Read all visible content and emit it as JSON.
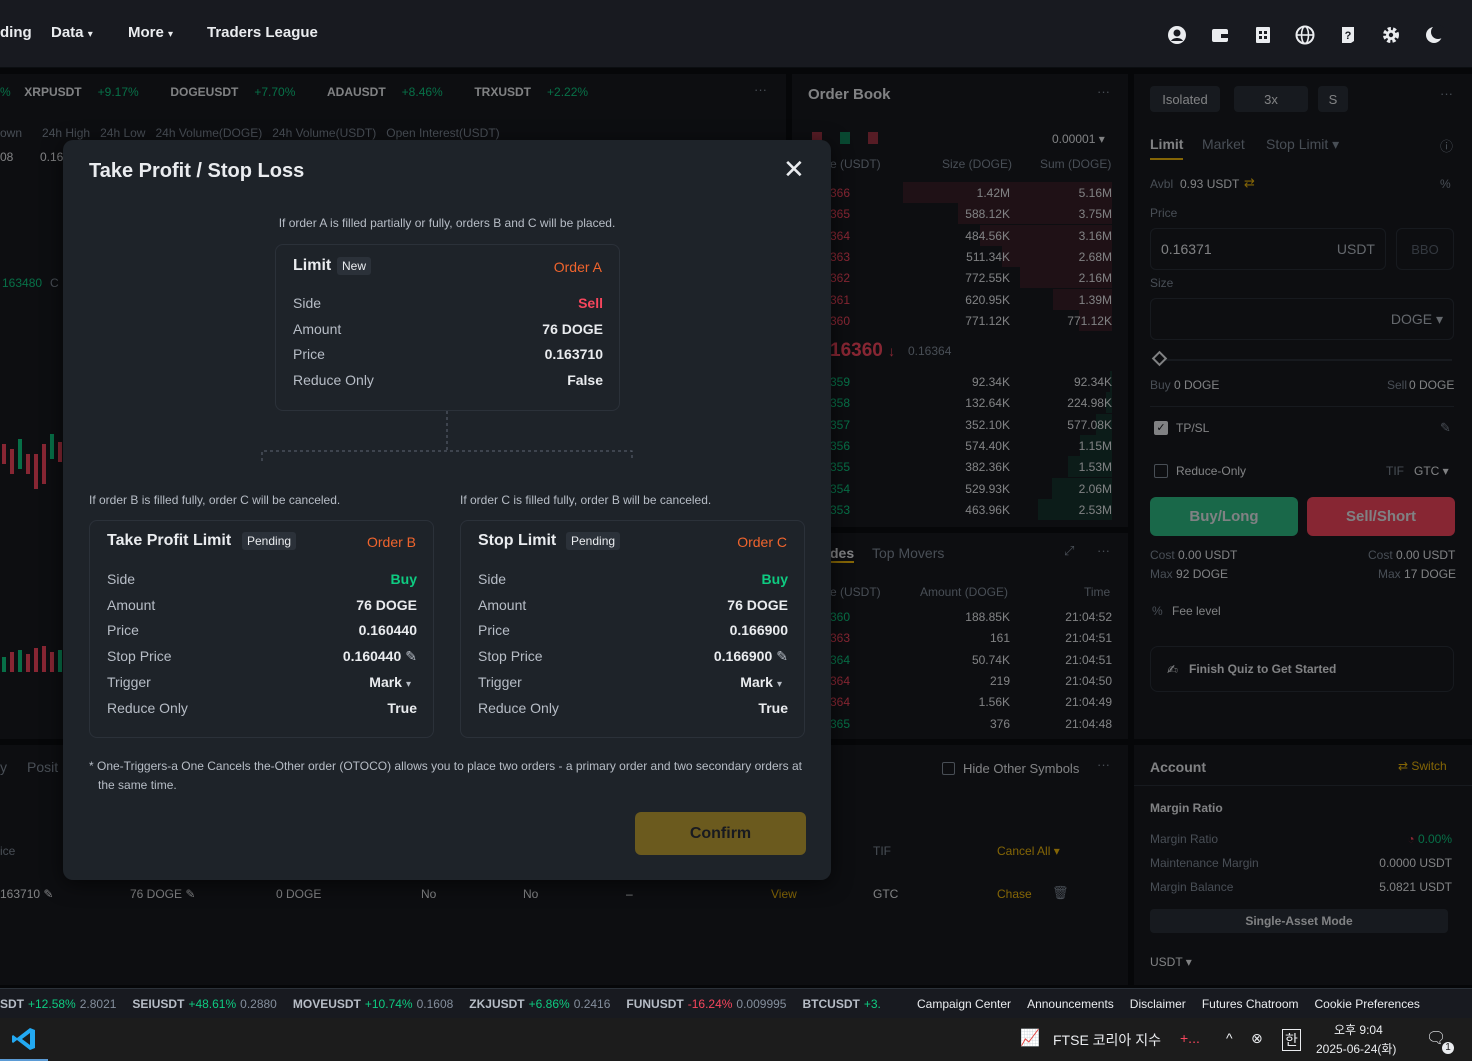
{
  "nav": {
    "partial": "ding",
    "data": "Data",
    "more": "More",
    "traders_league": "Traders League"
  },
  "ticker": [
    {
      "pct_only": "%"
    },
    {
      "sym": "XRPUSDT",
      "pct": "+9.17%"
    },
    {
      "sym": "DOGEUSDT",
      "pct": "+7.70%"
    },
    {
      "sym": "ADAUSDT",
      "pct": "+8.46%"
    },
    {
      "sym": "TRXUSDT",
      "pct": "+2.22%"
    }
  ],
  "stats": {
    "own": "own",
    "high": "24h High",
    "low": "24h Low",
    "vol_doge": "24h Volume(DOGE)",
    "vol_usdt": "24h Volume(USDT)",
    "oi": "Open Interest(USDT)",
    "v1": "08",
    "v2": "0.16"
  },
  "chart_fragment": {
    "price": "163480",
    "c": "C"
  },
  "orderbook": {
    "title": "Order Book",
    "tick": "0.00001",
    "cols": {
      "price": "e (USDT)",
      "size": "Size (DOGE)",
      "sum": "Sum (DOGE)"
    },
    "asks": [
      {
        "p": "366",
        "s": "1.42M",
        "t": "5.16M"
      },
      {
        "p": "365",
        "s": "588.12K",
        "t": "3.75M"
      },
      {
        "p": "364",
        "s": "484.56K",
        "t": "3.16M"
      },
      {
        "p": "363",
        "s": "511.34K",
        "t": "2.68M"
      },
      {
        "p": "362",
        "s": "772.55K",
        "t": "2.16M"
      },
      {
        "p": "361",
        "s": "620.95K",
        "t": "1.39M"
      },
      {
        "p": "360",
        "s": "771.12K",
        "t": "771.12K"
      }
    ],
    "last": "16360",
    "mark": "0.16364",
    "bids": [
      {
        "p": "359",
        "s": "92.34K",
        "t": "92.34K"
      },
      {
        "p": "358",
        "s": "132.64K",
        "t": "224.98K"
      },
      {
        "p": "357",
        "s": "352.10K",
        "t": "577.08K"
      },
      {
        "p": "356",
        "s": "574.40K",
        "t": "1.15M"
      },
      {
        "p": "355",
        "s": "382.36K",
        "t": "1.53M"
      },
      {
        "p": "354",
        "s": "529.93K",
        "t": "2.06M"
      },
      {
        "p": "353",
        "s": "463.96K",
        "t": "2.53M"
      }
    ]
  },
  "trades": {
    "tab1": "des",
    "tab2": "Top Movers",
    "cols": {
      "price": "e (USDT)",
      "amount": "Amount (DOGE)",
      "time": "Time"
    },
    "rows": [
      {
        "p": "360",
        "a": "188.85K",
        "t": "21:04:52",
        "c": "g"
      },
      {
        "p": "363",
        "a": "161",
        "t": "21:04:51",
        "c": "r"
      },
      {
        "p": "364",
        "a": "50.74K",
        "t": "21:04:51",
        "c": "g"
      },
      {
        "p": "364",
        "a": "219",
        "t": "21:04:50",
        "c": "r"
      },
      {
        "p": "364",
        "a": "1.56K",
        "t": "21:04:49",
        "c": "r"
      },
      {
        "p": "365",
        "a": "376",
        "t": "21:04:48",
        "c": "g"
      }
    ]
  },
  "positions": {
    "tab1": "y",
    "tab2": "Posit",
    "hide_other": "Hide Other Symbols",
    "col_ice": "ice",
    "col_tif": "TIF",
    "cancel_all": "Cancel All",
    "row": {
      "price": "163710",
      "amount": "76 DOGE",
      "filled": "0 DOGE",
      "no1": "No",
      "no2": "No",
      "dash": "–",
      "view": "View",
      "tif": "GTC",
      "chase": "Chase"
    }
  },
  "trade_panel": {
    "margin_mode": "Isolated",
    "leverage": "3x",
    "mode_s": "S",
    "tabs": {
      "limit": "Limit",
      "market": "Market",
      "stop_limit": "Stop Limit"
    },
    "avbl_label": "Avbl",
    "avbl": "0.93 USDT",
    "price_label": "Price",
    "price": "0.16371",
    "price_unit": "USDT",
    "bbo": "BBO",
    "size_label": "Size",
    "size_unit": "DOGE",
    "buy_label": "Buy",
    "buy_val": "0 DOGE",
    "sell_label": "Sell",
    "sell_val": "0 DOGE",
    "tpsl": "TP/SL",
    "reduce_only": "Reduce-Only",
    "tif_label": "TIF",
    "tif": "GTC",
    "buy_btn": "Buy/Long",
    "sell_btn": "Sell/Short",
    "cost_label": "Cost",
    "cost_buy": "0.00 USDT",
    "cost_sell": "0.00 USDT",
    "max_label": "Max",
    "max_buy": "92 DOGE",
    "max_sell": "17 DOGE",
    "fee_level": "Fee level",
    "quiz": "Finish Quiz to Get Started"
  },
  "account": {
    "title": "Account",
    "switch": "Switch",
    "margin_ratio_title": "Margin Ratio",
    "rows": [
      {
        "k": "Margin Ratio",
        "v": "0.00%"
      },
      {
        "k": "Maintenance Margin",
        "v": "0.0000 USDT"
      },
      {
        "k": "Margin Balance",
        "v": "5.0821 USDT"
      }
    ],
    "single_asset": "Single-Asset Mode",
    "asset": "USDT"
  },
  "bottom_ticker": [
    {
      "sym": "SDT",
      "pct": "+12.58%",
      "price": "2.8021",
      "c": "g"
    },
    {
      "sym": "SEIUSDT",
      "pct": "+48.61%",
      "price": "0.2880",
      "c": "g"
    },
    {
      "sym": "MOVEUSDT",
      "pct": "+10.74%",
      "price": "0.1608",
      "c": "g"
    },
    {
      "sym": "ZKJUSDT",
      "pct": "+6.86%",
      "price": "0.2416",
      "c": "g"
    },
    {
      "sym": "FUNUSDT",
      "pct": "-16.24%",
      "price": "0.009995",
      "c": "r"
    },
    {
      "sym": "BTCUSDT",
      "pct": "+3.",
      "price": "",
      "c": "g"
    }
  ],
  "bottom_links": [
    "Campaign Center",
    "Announcements",
    "Disclaimer",
    "Futures Chatroom",
    "Cookie Preferences"
  ],
  "modal": {
    "title": "Take Profit / Stop Loss",
    "note_a": "If order A is filled partially or fully, orders B and C will be placed.",
    "note_b": "If order B is filled fully, order C will be canceled.",
    "note_c": "If order C is filled fully, order B will be canceled.",
    "order_a": {
      "title": "Limit",
      "badge": "New",
      "tag": "Order A",
      "rows": [
        {
          "k": "Side",
          "v": "Sell"
        },
        {
          "k": "Amount",
          "v": "76 DOGE"
        },
        {
          "k": "Price",
          "v": "0.163710"
        },
        {
          "k": "Reduce Only",
          "v": "False"
        }
      ]
    },
    "order_b": {
      "title": "Take Profit Limit",
      "badge": "Pending",
      "tag": "Order B",
      "rows": [
        {
          "k": "Side",
          "v": "Buy"
        },
        {
          "k": "Amount",
          "v": "76 DOGE"
        },
        {
          "k": "Price",
          "v": "0.160440"
        },
        {
          "k": "Stop Price",
          "v": "0.160440"
        },
        {
          "k": "Trigger",
          "v": "Mark"
        },
        {
          "k": "Reduce Only",
          "v": "True"
        }
      ]
    },
    "order_c": {
      "title": "Stop Limit",
      "badge": "Pending",
      "tag": "Order C",
      "rows": [
        {
          "k": "Side",
          "v": "Buy"
        },
        {
          "k": "Amount",
          "v": "76 DOGE"
        },
        {
          "k": "Price",
          "v": "0.166900"
        },
        {
          "k": "Stop Price",
          "v": "0.166900"
        },
        {
          "k": "Trigger",
          "v": "Mark"
        },
        {
          "k": "Reduce Only",
          "v": "True"
        }
      ]
    },
    "footnote": "* One-Triggers-a One Cancels the-Other order (OTOCO) allows you to place two orders - a primary order and two secondary orders at the same time.",
    "confirm": "Confirm"
  },
  "taskbar": {
    "news": "FTSE 코리아 지수",
    "news_suffix": "+...",
    "time": "오후 9:04",
    "date": "2025-06-24(화)",
    "notif_count": "1"
  },
  "colors": {
    "green": "#0ecb81",
    "red": "#f6465d",
    "orange": "#f0642d",
    "yellow": "#f0b90b",
    "bg": "#181a20",
    "modal": "#1e2329"
  }
}
